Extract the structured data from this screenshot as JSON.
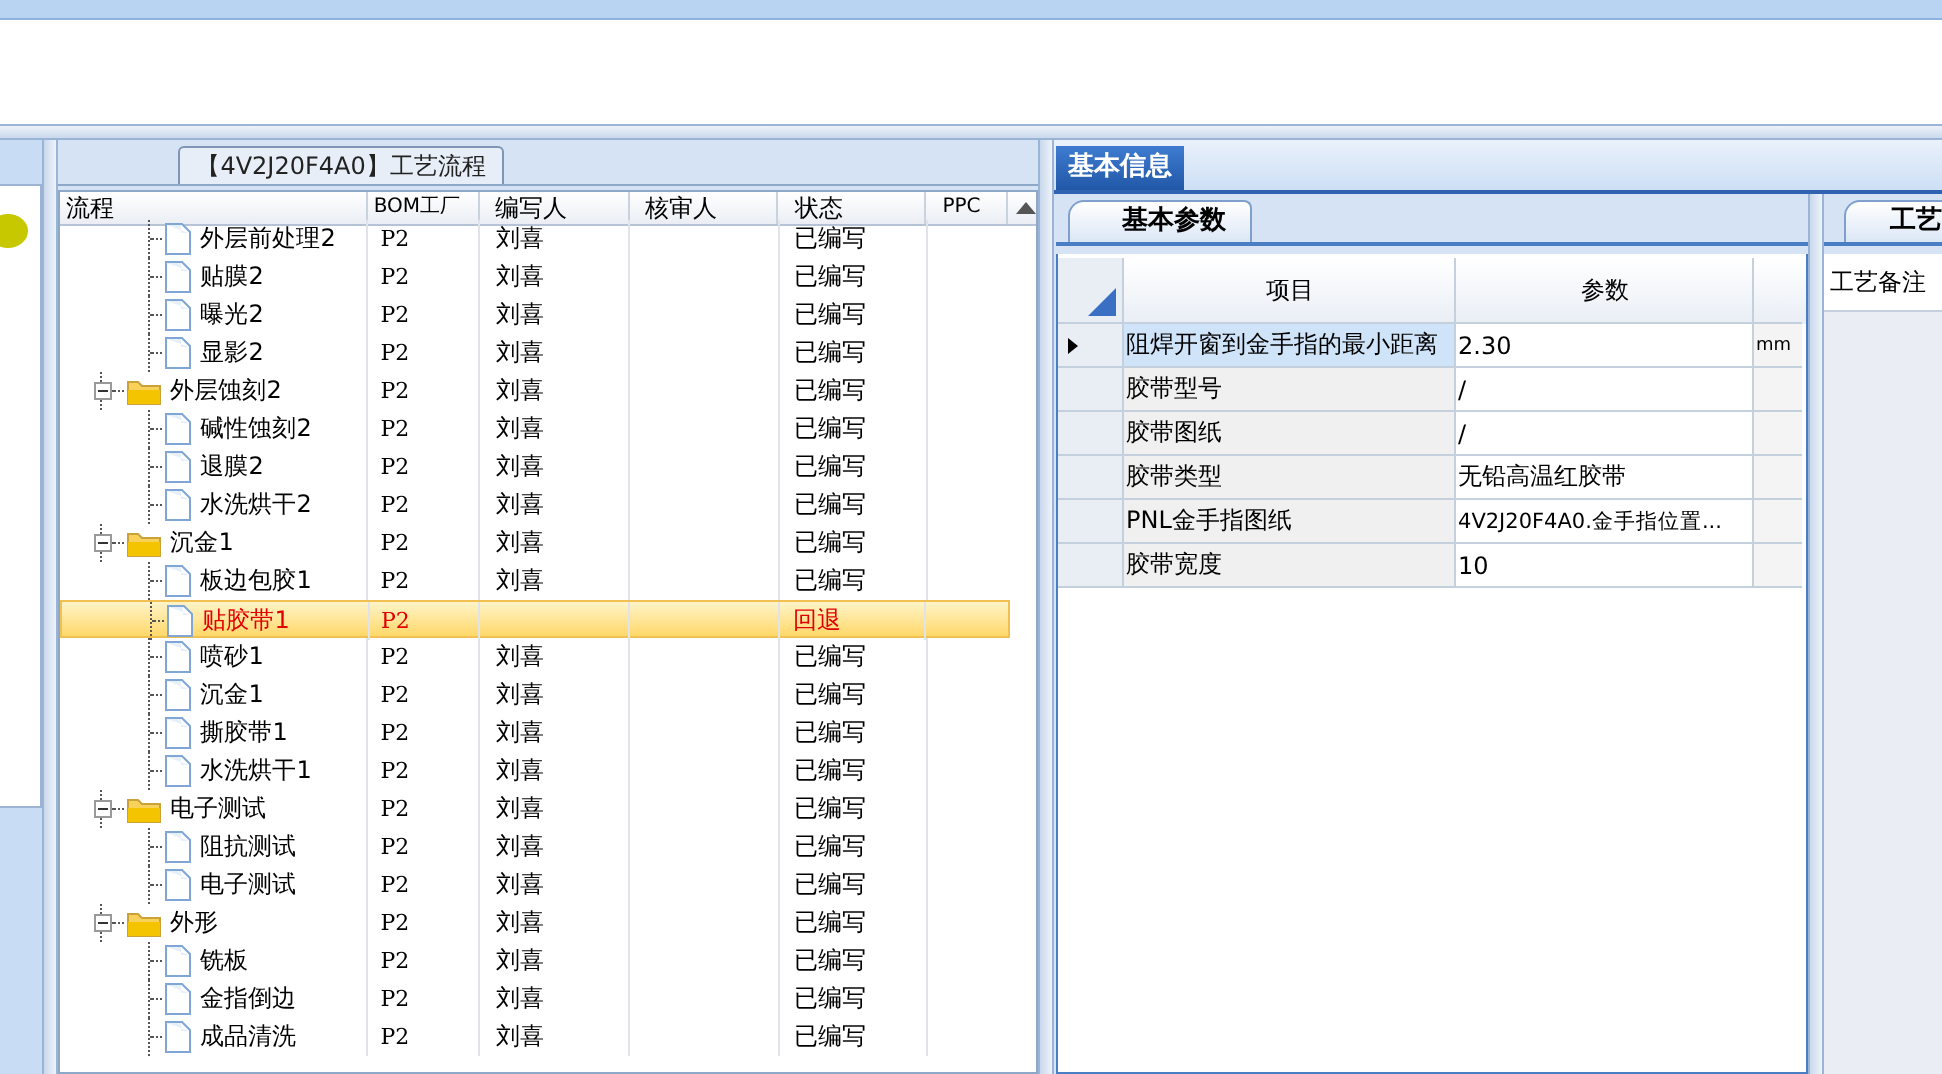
{
  "flow_panel": {
    "title": "【4V2J20F4A0】工艺流程",
    "columns": [
      "流程",
      "BOM工厂",
      "编写人",
      "核审人",
      "状态",
      "PPC"
    ],
    "partial_children": [
      {
        "label": "外层前处理2",
        "factory": "P2",
        "writer": "刘喜",
        "status": "已编写",
        "selected": false
      },
      {
        "label": "贴膜2",
        "factory": "P2",
        "writer": "刘喜",
        "status": "已编写",
        "selected": false
      },
      {
        "label": "曝光2",
        "factory": "P2",
        "writer": "刘喜",
        "status": "已编写",
        "selected": false
      },
      {
        "label": "显影2",
        "factory": "P2",
        "writer": "刘喜",
        "status": "已编写",
        "selected": false
      }
    ],
    "nodes": [
      {
        "label": "外层蚀刻2",
        "factory": "P2",
        "writer": "刘喜",
        "status": "已编写",
        "selected": false,
        "expanded": true,
        "children": [
          {
            "label": "碱性蚀刻2",
            "factory": "P2",
            "writer": "刘喜",
            "status": "已编写",
            "selected": false
          },
          {
            "label": "退膜2",
            "factory": "P2",
            "writer": "刘喜",
            "status": "已编写",
            "selected": false
          },
          {
            "label": "水洗烘干2",
            "factory": "P2",
            "writer": "刘喜",
            "status": "已编写",
            "selected": false
          }
        ]
      },
      {
        "label": "沉金1",
        "factory": "P2",
        "writer": "刘喜",
        "status": "已编写",
        "selected": false,
        "expanded": true,
        "children": [
          {
            "label": "板边包胶1",
            "factory": "P2",
            "writer": "刘喜",
            "status": "已编写",
            "selected": false
          },
          {
            "label": "贴胶带1",
            "factory": "P2",
            "status": "回退",
            "selected": true
          },
          {
            "label": "喷砂1",
            "factory": "P2",
            "writer": "刘喜",
            "status": "已编写",
            "selected": false
          },
          {
            "label": "沉金1",
            "factory": "P2",
            "writer": "刘喜",
            "status": "已编写",
            "selected": false
          },
          {
            "label": "撕胶带1",
            "factory": "P2",
            "writer": "刘喜",
            "status": "已编写",
            "selected": false
          },
          {
            "label": "水洗烘干1",
            "factory": "P2",
            "writer": "刘喜",
            "status": "已编写",
            "selected": false
          }
        ]
      },
      {
        "label": "电子测试",
        "factory": "P2",
        "writer": "刘喜",
        "status": "已编写",
        "selected": false,
        "expanded": true,
        "children": [
          {
            "label": "阻抗测试",
            "factory": "P2",
            "writer": "刘喜",
            "status": "已编写",
            "selected": false
          },
          {
            "label": "电子测试",
            "factory": "P2",
            "writer": "刘喜",
            "status": "已编写",
            "selected": false
          }
        ]
      },
      {
        "label": "外形",
        "factory": "P2",
        "writer": "刘喜",
        "status": "已编写",
        "selected": false,
        "expanded": true,
        "children": [
          {
            "label": "铣板",
            "factory": "P2",
            "writer": "刘喜",
            "status": "已编写",
            "selected": false
          },
          {
            "label": "金指倒边",
            "factory": "P2",
            "writer": "刘喜",
            "status": "已编写",
            "selected": false
          },
          {
            "label": "成品清洗",
            "factory": "P2",
            "writer": "刘喜",
            "status": "已编写",
            "selected": false
          }
        ]
      }
    ]
  },
  "info_tabs": [
    {
      "label": "基本信息",
      "selected": true
    }
  ],
  "param_tabs": [
    {
      "label": "基本参数",
      "selected": true
    }
  ],
  "params": {
    "columns": [
      "项目",
      "参数"
    ],
    "rows": [
      {
        "item": "阻焊开窗到金手指的最小距离",
        "value": "2.30",
        "unit": "mm",
        "selected": true
      },
      {
        "item": "胶带型号",
        "value": "/",
        "selected": false
      },
      {
        "item": "胶带图纸",
        "value": "/",
        "selected": false
      },
      {
        "item": "胶带类型",
        "value": "无铅高温红胶带",
        "selected": false
      },
      {
        "item": "PNL金手指图纸",
        "value": "4V2J20F4A0.金手指位置...",
        "selected": false
      },
      {
        "item": "胶带宽度",
        "value": "10",
        "selected": false
      }
    ]
  },
  "notes_panel": {
    "tab": "工艺",
    "header": "工艺备注"
  }
}
